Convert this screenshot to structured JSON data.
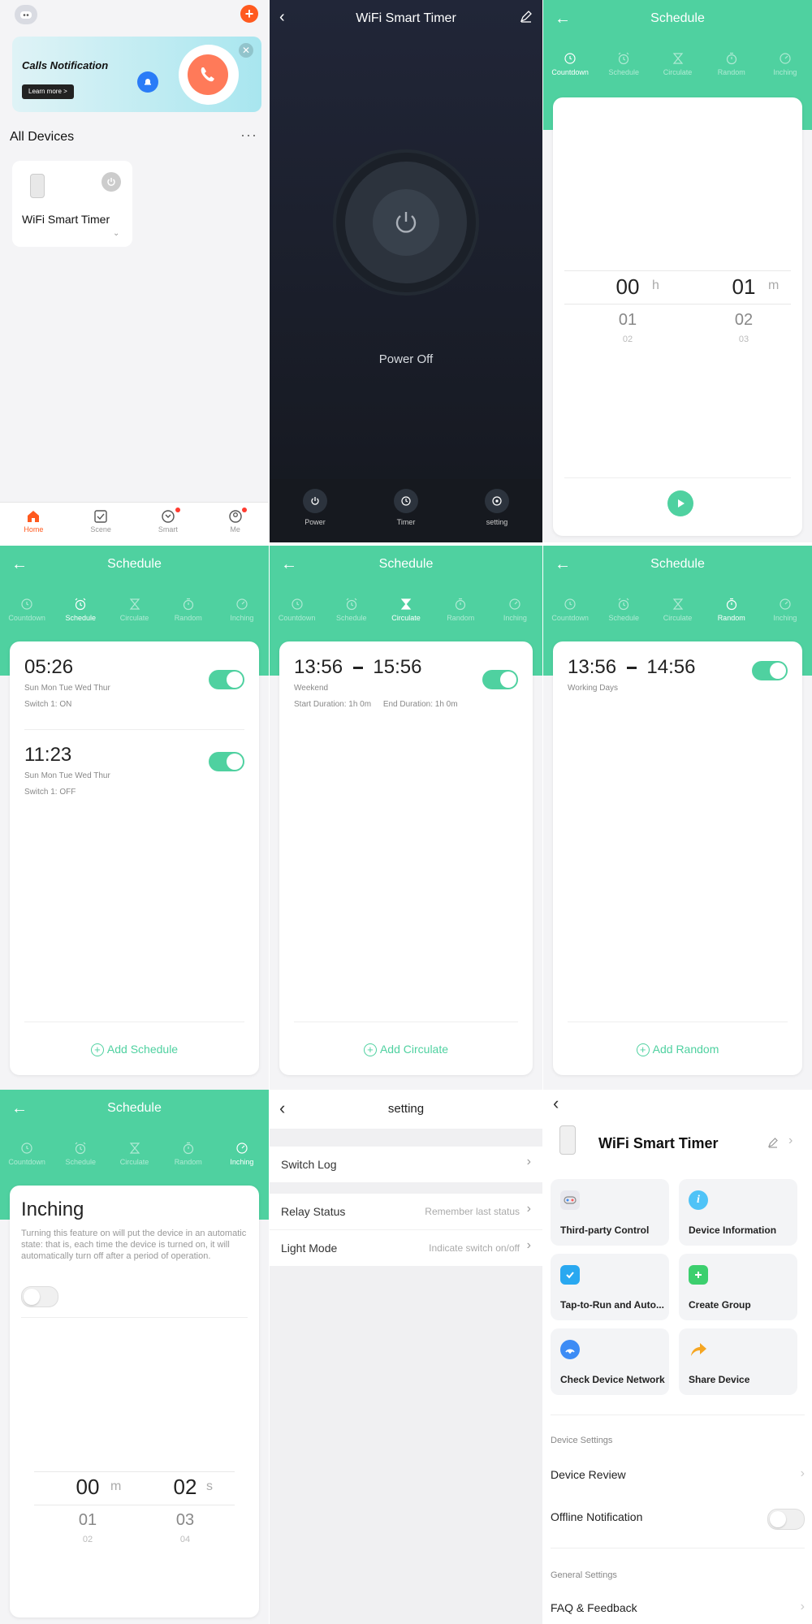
{
  "home": {
    "banner_title": "Calls Notification",
    "banner_button": "Learn more >",
    "section_title": "All Devices",
    "more_glyph": "···",
    "device_name": "WiFi Smart Timer",
    "nav": [
      {
        "label": "Home"
      },
      {
        "label": "Scene"
      },
      {
        "label": "Smart"
      },
      {
        "label": "Me"
      }
    ],
    "accent_color": "#ff5a1f"
  },
  "device": {
    "title": "WiFi Smart Timer",
    "status": "Power Off",
    "bottom": [
      {
        "label": "Power"
      },
      {
        "label": "Timer"
      },
      {
        "label": "setting"
      }
    ]
  },
  "schedule": {
    "title": "Schedule",
    "tabs": [
      {
        "label": "Countdown"
      },
      {
        "label": "Schedule"
      },
      {
        "label": "Circulate"
      },
      {
        "label": "Random"
      },
      {
        "label": "Inching"
      }
    ],
    "accent_color": "#4fd1a0"
  },
  "countdown": {
    "hours": [
      "00",
      "01",
      "02"
    ],
    "minutes": [
      "01",
      "02",
      "03"
    ],
    "h_unit": "h",
    "m_unit": "m"
  },
  "schedule_list": {
    "items": [
      {
        "time": "05:26",
        "days": "Sun Mon Tue Wed Thur",
        "action": "Switch 1: ON"
      },
      {
        "time": "11:23",
        "days": "Sun Mon Tue Wed Thur",
        "action": "Switch 1: OFF"
      }
    ],
    "add_label": "Add Schedule"
  },
  "circulate": {
    "start": "13:56",
    "end": "15:56",
    "days": "Weekend",
    "start_duration": "Start Duration: 1h 0m",
    "end_duration": "End Duration: 1h 0m",
    "add_label": "Add Circulate"
  },
  "random": {
    "start": "13:56",
    "end": "14:56",
    "days": "Working Days",
    "add_label": "Add Random"
  },
  "inching": {
    "title": "Inching",
    "description": "Turning this feature on will put the device in an automatic state: that is, each time the device is turned on, it will automatically turn off after a period of operation.",
    "minutes": [
      "00",
      "01",
      "02"
    ],
    "seconds": [
      "02",
      "03",
      "04"
    ],
    "m_unit": "m",
    "s_unit": "s"
  },
  "setting": {
    "title": "setting",
    "switch_log": "Switch Log",
    "relay_label": "Relay Status",
    "relay_value": "Remember last status",
    "light_label": "Light Mode",
    "light_value": "Indicate switch on/off"
  },
  "detail": {
    "name": "WiFi Smart Timer",
    "tiles": [
      {
        "label": "Third-party Control",
        "color": "#e8e8ee"
      },
      {
        "label": "Device Information",
        "color": "#4fc3f7"
      },
      {
        "label": "Tap-to-Run and Auto...",
        "color": "#29a8f0"
      },
      {
        "label": "Create Group",
        "color": "#3ccf6e"
      },
      {
        "label": "Check Device Network",
        "color": "#3d8cf5"
      },
      {
        "label": "Share Device",
        "color": "#f5a623"
      }
    ],
    "device_settings": "Device Settings",
    "device_review": "Device Review",
    "offline_notification": "Offline Notification",
    "general_settings": "General Settings",
    "faq": "FAQ & Feedback"
  }
}
